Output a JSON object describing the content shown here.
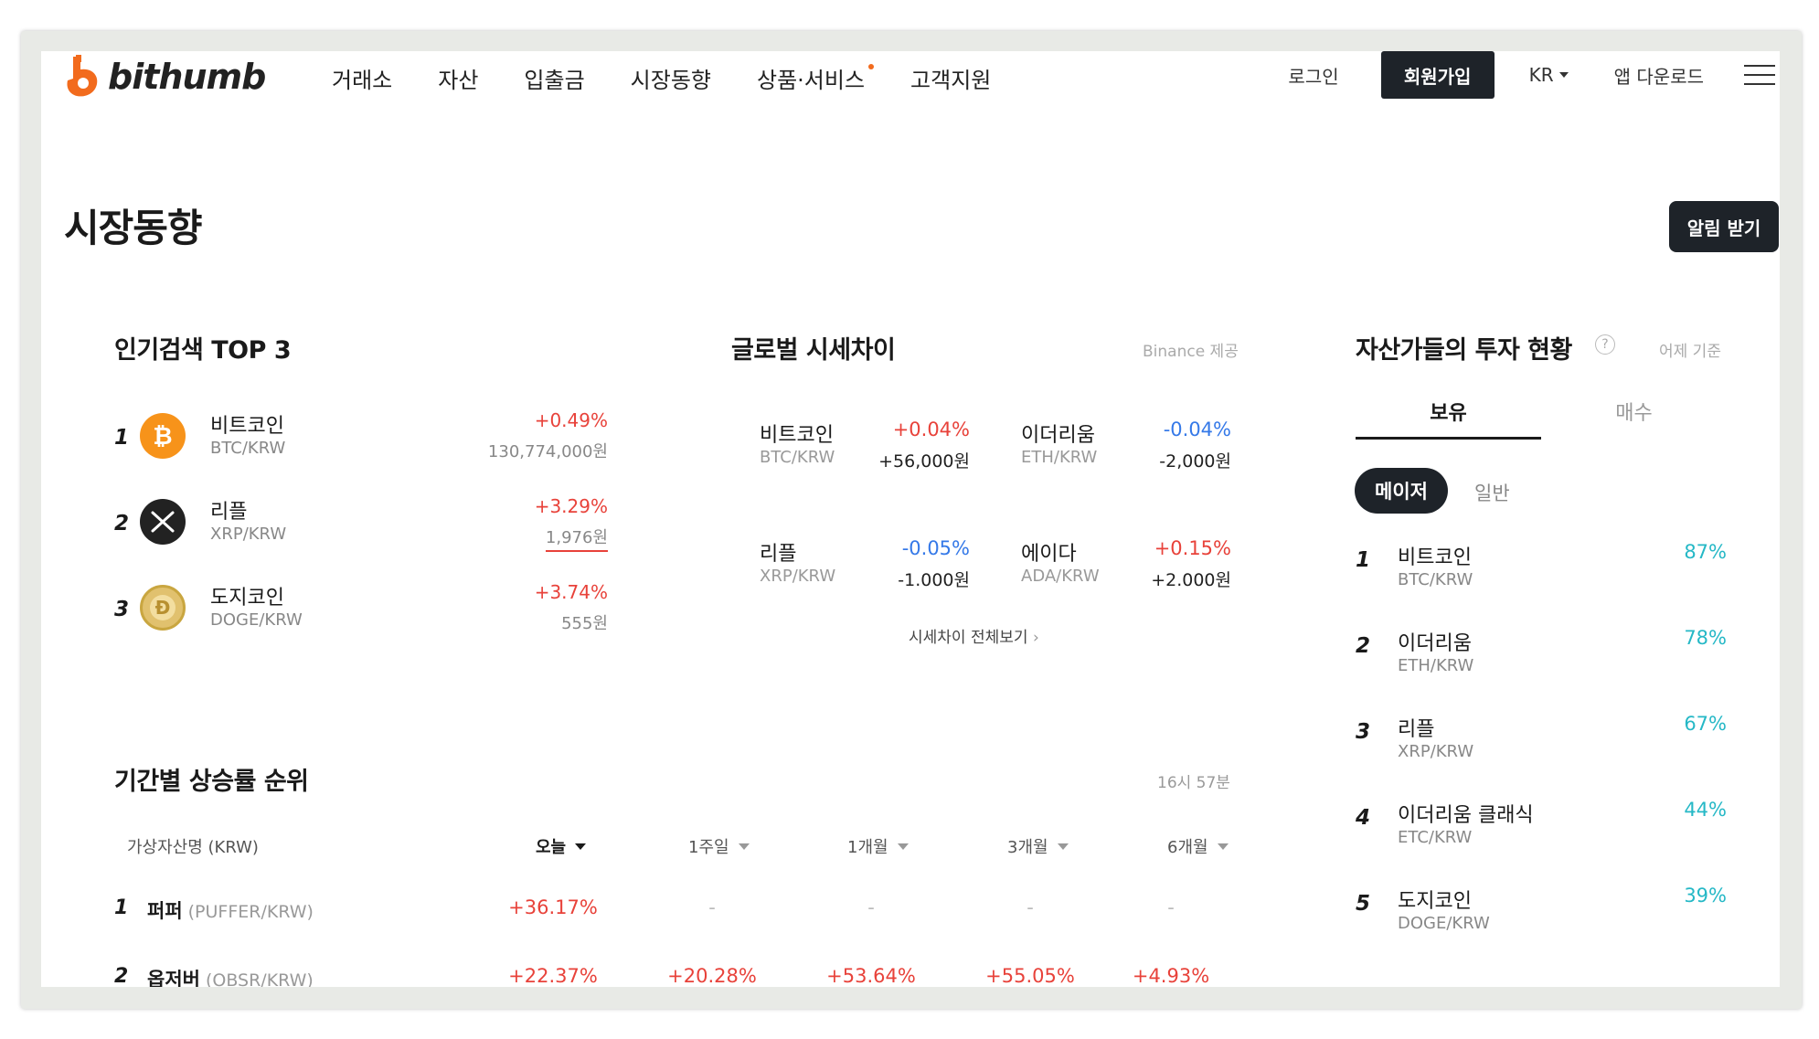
{
  "header": {
    "logo_text": "bithumb",
    "nav": [
      "거래소",
      "자산",
      "입출금",
      "시장동향",
      "상품·서비스",
      "고객지원"
    ],
    "login": "로그인",
    "signup": "회원가입",
    "lang": "KR",
    "app_download": "앱 다운로드"
  },
  "page": {
    "title": "시장동향",
    "alert_button": "알림 받기"
  },
  "popular": {
    "title": "인기검색 TOP 3",
    "items": [
      {
        "rank": "1",
        "name": "비트코인",
        "pair": "BTC/KRW",
        "change": "+0.49%",
        "price": "130,774,000원"
      },
      {
        "rank": "2",
        "name": "리플",
        "pair": "XRP/KRW",
        "change": "+3.29%",
        "price": "1,976원"
      },
      {
        "rank": "3",
        "name": "도지코인",
        "pair": "DOGE/KRW",
        "change": "+3.74%",
        "price": "555원"
      }
    ]
  },
  "global_diff": {
    "title": "글로벌 시세차이",
    "note": "Binance 제공",
    "items": [
      {
        "name": "비트코인",
        "pair": "BTC/KRW",
        "pct": "+0.04%",
        "amount": "+56,000원",
        "dir": "up"
      },
      {
        "name": "이더리움",
        "pair": "ETH/KRW",
        "pct": "-0.04%",
        "amount": "-2,000원",
        "dir": "down"
      },
      {
        "name": "리플",
        "pair": "XRP/KRW",
        "pct": "-0.05%",
        "amount": "-1.000원",
        "dir": "down"
      },
      {
        "name": "에이다",
        "pair": "ADA/KRW",
        "pct": "+0.15%",
        "amount": "+2.000원",
        "dir": "up"
      }
    ],
    "see_all": "시세차이 전체보기"
  },
  "investors": {
    "title": "자산가들의 투자 현황",
    "note": "어제 기준",
    "tabs": [
      "보유",
      "매수"
    ],
    "pills": [
      "메이저",
      "일반"
    ],
    "items": [
      {
        "rank": "1",
        "name": "비트코인",
        "pair": "BTC/KRW",
        "pct": "87%"
      },
      {
        "rank": "2",
        "name": "이더리움",
        "pair": "ETH/KRW",
        "pct": "78%"
      },
      {
        "rank": "3",
        "name": "리플",
        "pair": "XRP/KRW",
        "pct": "67%"
      },
      {
        "rank": "4",
        "name": "이더리움 클래식",
        "pair": "ETC/KRW",
        "pct": "44%"
      },
      {
        "rank": "5",
        "name": "도지코인",
        "pair": "DOGE/KRW",
        "pct": "39%"
      }
    ]
  },
  "ranking": {
    "title": "기간별 상승률 순위",
    "time": "16시 57분",
    "columns": [
      "가상자산명 (KRW)",
      "오늘",
      "1주일",
      "1개월",
      "3개월",
      "6개월"
    ],
    "rows": [
      {
        "rank": "1",
        "name": "퍼퍼",
        "pair": "(PUFFER/KRW)",
        "values": [
          "+36.17%",
          "-",
          "-",
          "-",
          "-"
        ]
      },
      {
        "rank": "2",
        "name": "옵저버",
        "pair": "(OBSR/KRW)",
        "values": [
          "+22.37%",
          "+20.28%",
          "+53.64%",
          "+55.05%",
          "+4.93%"
        ]
      }
    ]
  },
  "colors": {
    "up": "#e8423a",
    "down": "#3579e8",
    "teal": "#25b8c6",
    "dark": "#1e2329",
    "accent": "#f26b1d"
  }
}
